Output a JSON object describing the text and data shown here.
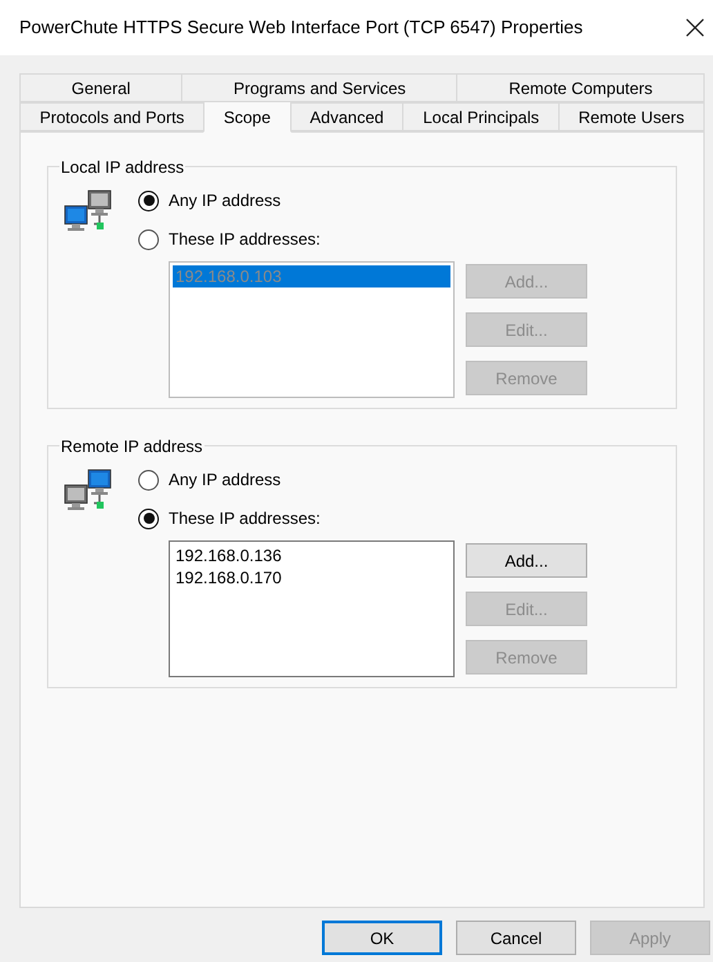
{
  "window": {
    "title": "PowerChute HTTPS Secure Web Interface Port (TCP 6547) Properties"
  },
  "tab_rows": [
    [
      {
        "label": "General",
        "selected": false
      },
      {
        "label": "Programs and Services",
        "selected": false
      },
      {
        "label": "Remote Computers",
        "selected": false
      }
    ],
    [
      {
        "label": "Protocols and Ports",
        "selected": false
      },
      {
        "label": "Scope",
        "selected": true
      },
      {
        "label": "Advanced",
        "selected": false
      },
      {
        "label": "Local Principals",
        "selected": false
      },
      {
        "label": "Remote Users",
        "selected": false
      }
    ]
  ],
  "groups": [
    {
      "kind": "local",
      "legend": "Local IP address",
      "options": [
        {
          "label": "Any IP address",
          "selected": true
        },
        {
          "label": "These IP addresses:",
          "selected": false
        }
      ],
      "list_disabled": true,
      "addresses": [
        {
          "text": "192.168.0.103",
          "selected": true
        }
      ],
      "buttons": [
        {
          "label": "Add...",
          "disabled": true
        },
        {
          "label": "Edit...",
          "disabled": true
        },
        {
          "label": "Remove",
          "disabled": true
        }
      ]
    },
    {
      "kind": "remote",
      "legend": "Remote IP address",
      "options": [
        {
          "label": "Any IP address",
          "selected": false
        },
        {
          "label": "These IP addresses:",
          "selected": true
        }
      ],
      "list_disabled": false,
      "addresses": [
        {
          "text": "192.168.0.136",
          "selected": false
        },
        {
          "text": "192.168.0.170",
          "selected": false
        }
      ],
      "buttons": [
        {
          "label": "Add...",
          "disabled": false
        },
        {
          "label": "Edit...",
          "disabled": true
        },
        {
          "label": "Remove",
          "disabled": true
        }
      ]
    }
  ],
  "footer_buttons": [
    {
      "label": "OK",
      "default": true,
      "disabled": false
    },
    {
      "label": "Cancel",
      "default": false,
      "disabled": false
    },
    {
      "label": "Apply",
      "default": false,
      "disabled": true
    }
  ]
}
